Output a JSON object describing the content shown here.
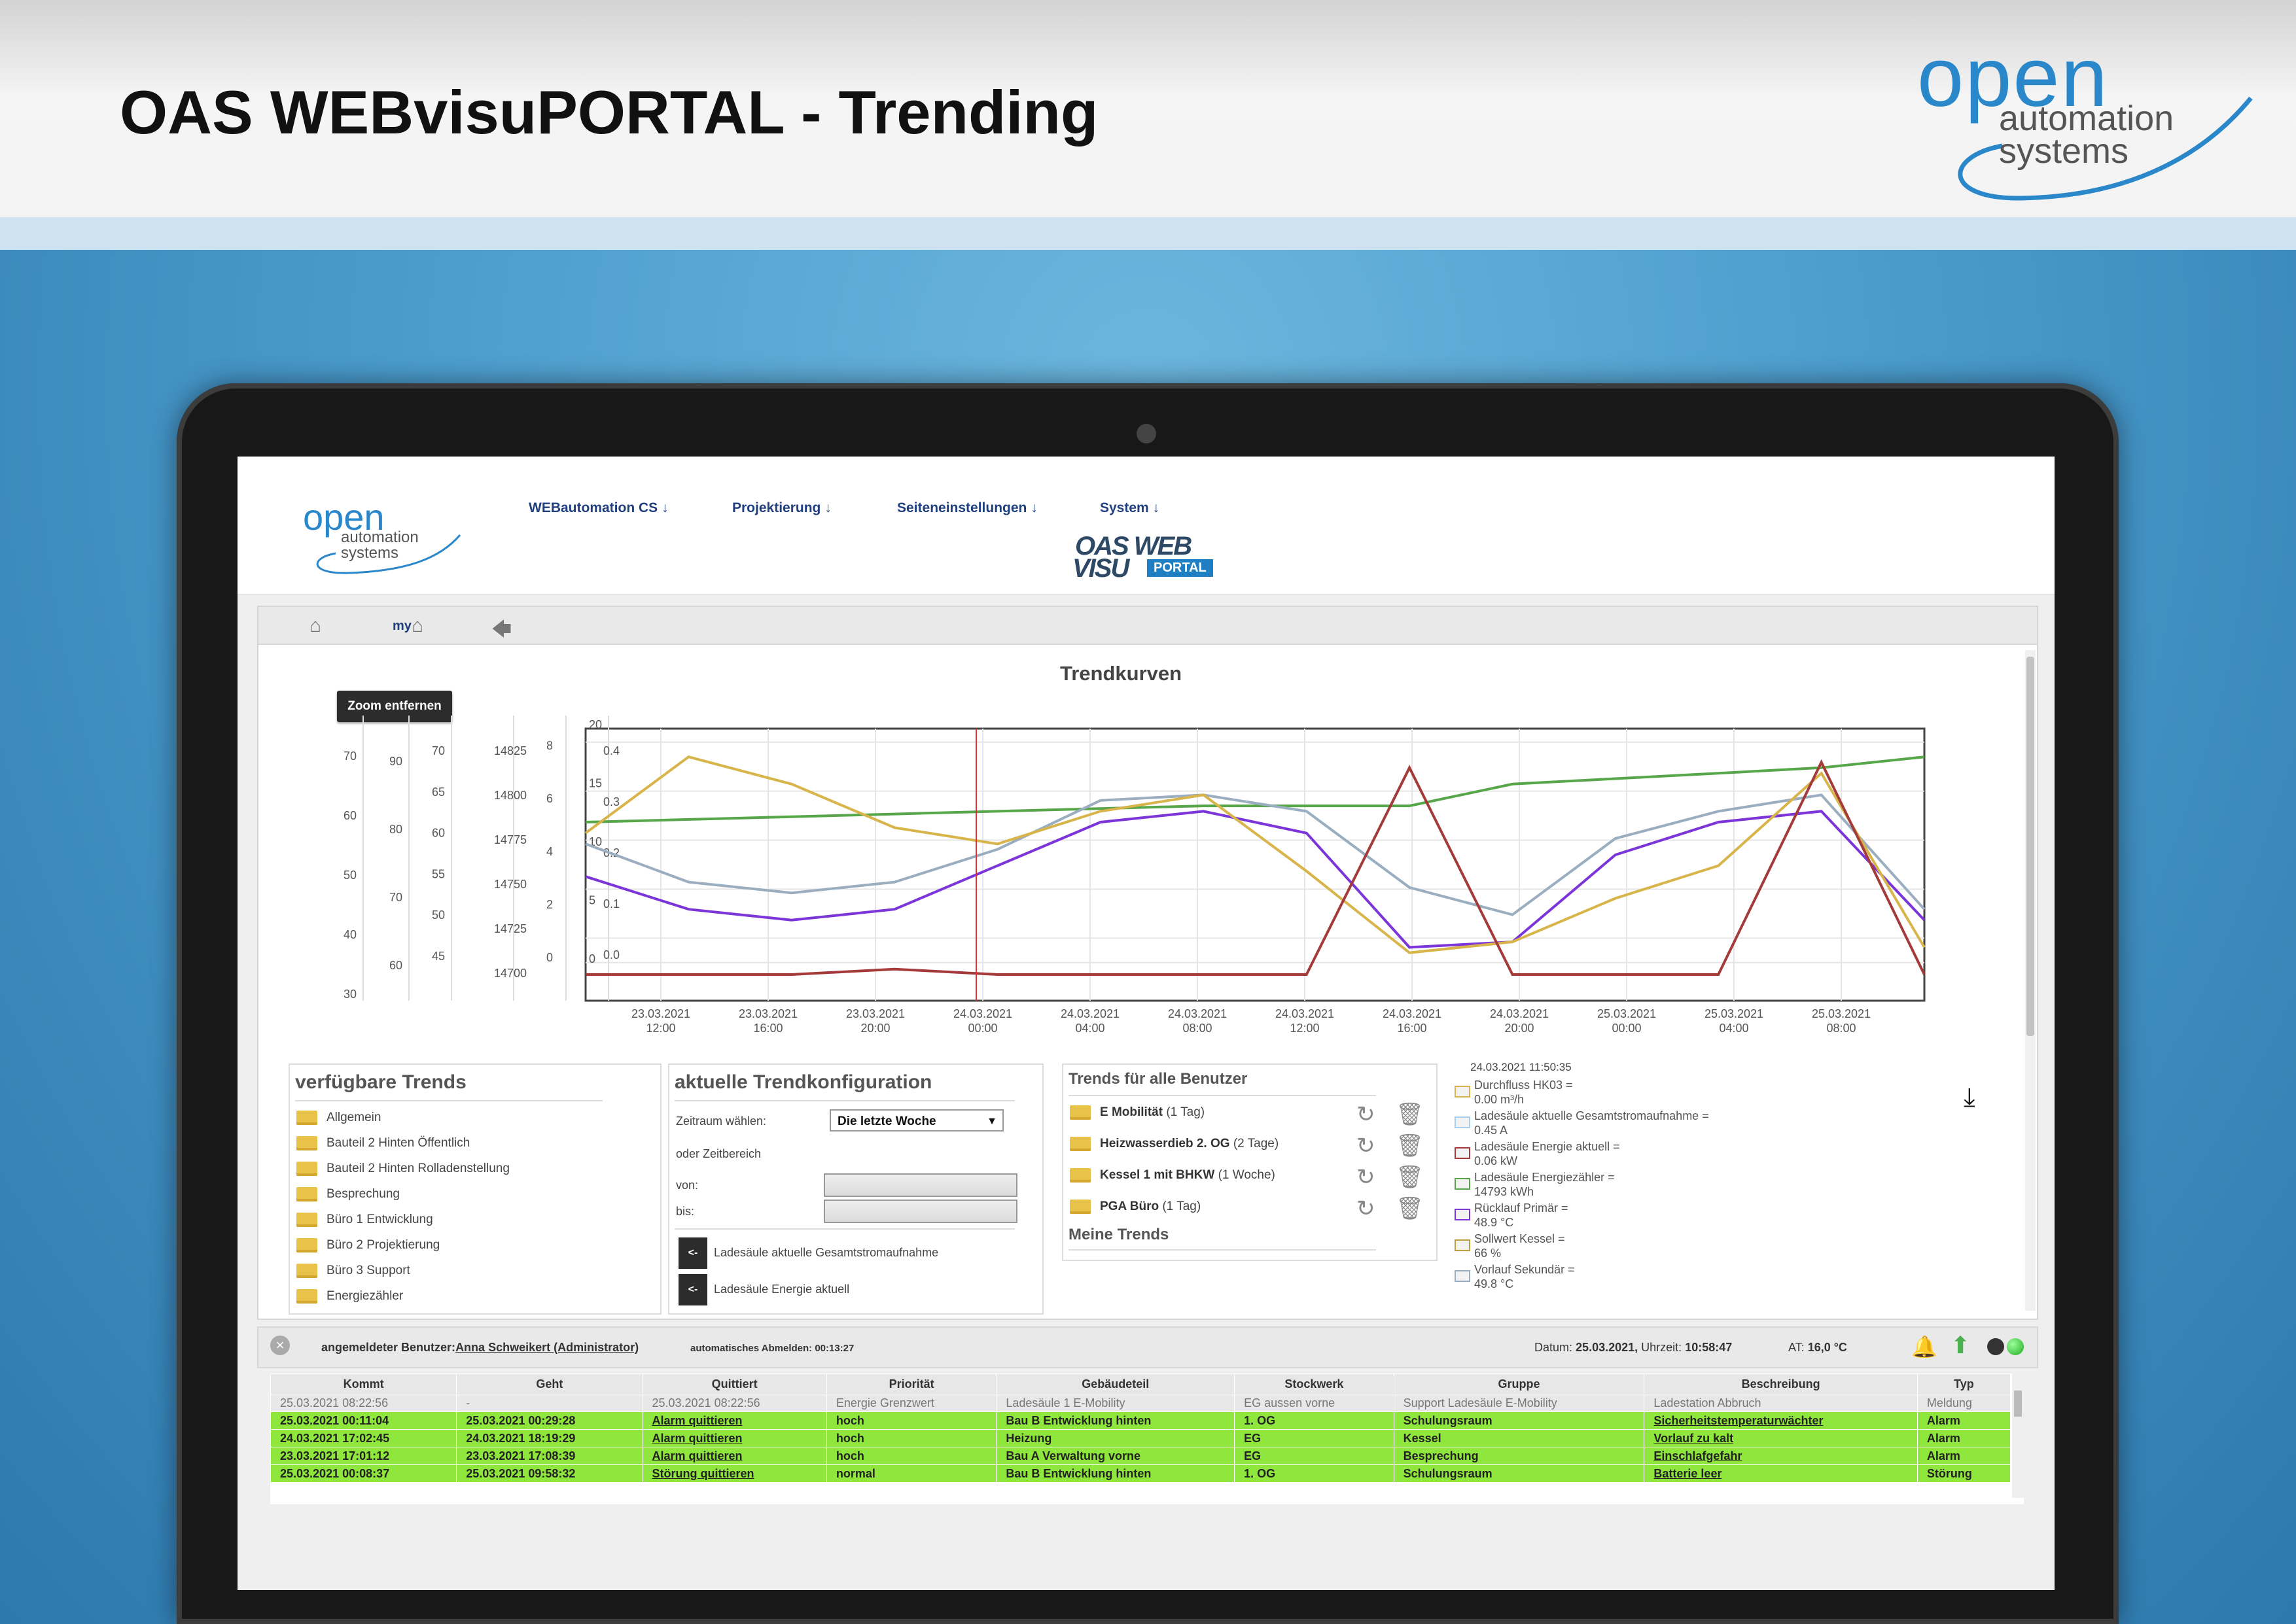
{
  "slide": {
    "title": "OAS WEBvisuPORTAL - Trending",
    "logo": {
      "line1": "open",
      "line2": "automation",
      "line3": "systems"
    }
  },
  "app": {
    "logo": {
      "line1": "open",
      "line2": "automation",
      "line3": "systems"
    },
    "nav": [
      "WEBautomation CS ↓",
      "Projektierung ↓",
      "Seiteneinstellungen ↓",
      "System ↓"
    ],
    "brand": {
      "line1": "OAS WEB",
      "line2": "VISU",
      "badge": "PORTAL"
    },
    "toolbar": {
      "my_label": "my",
      "icons": [
        "home-icon",
        "my-home-icon",
        "back-arrow-icon"
      ]
    }
  },
  "chart": {
    "title": "Trendkurven",
    "zoom_button": "Zoom entfernen"
  },
  "chart_data": {
    "type": "line",
    "title": "Trendkurven",
    "x_ticks": [
      [
        "23.03.2021",
        "12:00"
      ],
      [
        "23.03.2021",
        "16:00"
      ],
      [
        "23.03.2021",
        "20:00"
      ],
      [
        "24.03.2021",
        "00:00"
      ],
      [
        "24.03.2021",
        "04:00"
      ],
      [
        "24.03.2021",
        "08:00"
      ],
      [
        "24.03.2021",
        "12:00"
      ],
      [
        "24.03.2021",
        "16:00"
      ],
      [
        "24.03.2021",
        "20:00"
      ],
      [
        "25.03.2021",
        "00:00"
      ],
      [
        "25.03.2021",
        "04:00"
      ],
      [
        "25.03.2021",
        "08:00"
      ]
    ],
    "axes": [
      {
        "ticks": [
          "70",
          "60",
          "50",
          "40",
          "30"
        ]
      },
      {
        "ticks": [
          "90",
          "80",
          "70",
          "60"
        ]
      },
      {
        "ticks": [
          "70",
          "65",
          "60",
          "55",
          "50",
          "45"
        ]
      },
      {
        "ticks": [
          "14825",
          "14800",
          "14775",
          "14750",
          "14725",
          "14700"
        ]
      },
      {
        "ticks": [
          "8",
          "6",
          "4",
          "2",
          "0"
        ]
      },
      {
        "ticks": [
          "20",
          "15",
          "10",
          "5",
          "0"
        ]
      },
      {
        "ticks": [
          "0.4",
          "0.3",
          "0.2",
          "0.1",
          "0.0"
        ]
      }
    ],
    "series": [
      {
        "color": "#57a64a",
        "values": [
          0.28,
          0.285,
          0.29,
          0.295,
          0.3,
          0.305,
          0.31,
          0.31,
          0.31,
          0.35,
          0.36,
          0.37,
          0.38,
          0.4
        ]
      },
      {
        "color": "#9aaec0",
        "values": [
          0.24,
          0.17,
          0.15,
          0.17,
          0.23,
          0.32,
          0.33,
          0.3,
          0.16,
          0.11,
          0.25,
          0.3,
          0.33,
          0.12
        ]
      },
      {
        "color": "#7b35d8",
        "values": [
          0.18,
          0.12,
          0.1,
          0.12,
          0.2,
          0.28,
          0.3,
          0.26,
          0.05,
          0.06,
          0.22,
          0.28,
          0.3,
          0.1
        ]
      },
      {
        "color": "#d7b54b",
        "values": [
          0.26,
          0.4,
          0.35,
          0.27,
          0.24,
          0.3,
          0.33,
          0.19,
          0.04,
          0.06,
          0.14,
          0.2,
          0.37,
          0.05
        ]
      },
      {
        "color": "#a33b3b",
        "values": [
          0.0,
          0.0,
          0.0,
          0.01,
          0.0,
          0.0,
          0.0,
          0.0,
          0.38,
          0.0,
          0.0,
          0.0,
          0.39,
          0.0
        ]
      }
    ]
  },
  "panels": {
    "available": {
      "title": "verfügbare Trends",
      "items": [
        "Allgemein",
        "Bauteil 2 Hinten Öffentlich",
        "Bauteil 2 Hinten Rolladenstellung",
        "Besprechung",
        "Büro 1 Entwicklung",
        "Büro 2 Projektierung",
        "Büro 3 Support",
        "Energiezähler"
      ]
    },
    "config": {
      "title": "aktuelle Trendkonfiguration",
      "zeitraum_label": "Zeitraum wählen:",
      "zeitraum_value": "Die letzte Woche",
      "oder_label": "oder Zeitbereich",
      "von_label": "von:",
      "bis_label": "bis:",
      "selected": [
        {
          "button": "<-",
          "label": "Ladesäule aktuelle Gesamtstromaufnahme"
        },
        {
          "button": "<-",
          "label": "Ladesäule Energie aktuell"
        }
      ]
    },
    "user_trends": {
      "title": "Trends für alle Benutzer",
      "items": [
        {
          "name": "E Mobilität",
          "period": "(1 Tag)"
        },
        {
          "name": "Heizwasserdieb 2. OG",
          "period": "(2 Tage)"
        },
        {
          "name": "Kessel 1 mit BHKW",
          "period": "(1 Woche)"
        },
        {
          "name": "PGA Büro",
          "period": "(1 Tag)"
        }
      ],
      "my_trends_title": "Meine Trends"
    },
    "legend": {
      "timestamp": "24.03.2021 11:50:35",
      "items": [
        {
          "line1": "Durchfluss HK03 =",
          "line2": "0.00 m³/h",
          "color": "#d7b54b"
        },
        {
          "line1": "Ladesäule aktuelle Gesamtstromaufnahme =",
          "line2": "0.45 A",
          "color": "#a8d0ee"
        },
        {
          "line1": "Ladesäule Energie aktuell =",
          "line2": "0.06 kW",
          "color": "#a33b3b"
        },
        {
          "line1": "Ladesäule Energiezähler =",
          "line2": "14793 kWh",
          "color": "#57a64a"
        },
        {
          "line1": "Rücklauf Primär =",
          "line2": "48.9 °C",
          "color": "#7b35d8"
        },
        {
          "line1": "Sollwert Kessel =",
          "line2": "66 %",
          "color": "#b8a040"
        },
        {
          "line1": "Vorlauf Sekundär =",
          "line2": "49.8 °C",
          "color": "#9aaec0"
        }
      ]
    }
  },
  "status": {
    "user_prefix": "angemeldeter Benutzer:",
    "user_name": "Anna Schweikert (Administrator)",
    "logout": "automatisches Abmelden: 00:13:27",
    "date_label": "Datum:",
    "date": "25.03.2021,",
    "time_label": "Uhrzeit:",
    "time": "10:58:47",
    "at_label": "AT:",
    "temp": "16,0 °C"
  },
  "alarms": {
    "headers": [
      "Kommt",
      "Geht",
      "Quittiert",
      "Priorität",
      "Gebäudeteil",
      "Stockwerk",
      "Gruppe",
      "Beschreibung",
      "Typ"
    ],
    "rows": [
      [
        "25.03.2021 08:22:56",
        "-",
        "25.03.2021 08:22:56",
        "Energie Grenzwert",
        "Ladesäule 1 E-Mobility",
        "EG aussen vorne",
        "Support Ladesäule E-Mobility",
        "Ladestation Abbruch",
        "Meldung"
      ],
      [
        "25.03.2021 00:11:04",
        "25.03.2021 00:29:28",
        "Alarm quittieren",
        "hoch",
        "Bau B Entwicklung hinten",
        "1. OG",
        "Schulungsraum",
        "Sicherheitstemperaturwächter",
        "Alarm"
      ],
      [
        "24.03.2021 17:02:45",
        "24.03.2021 18:19:29",
        "Alarm quittieren",
        "hoch",
        "Heizung",
        "EG",
        "Kessel",
        "Vorlauf zu kalt",
        "Alarm"
      ],
      [
        "23.03.2021 17:01:12",
        "23.03.2021 17:08:39",
        "Alarm quittieren",
        "hoch",
        "Bau A Verwaltung vorne",
        "EG",
        "Besprechung",
        "Einschlafgefahr",
        "Alarm"
      ],
      [
        "25.03.2021 00:08:37",
        "25.03.2021 09:58:32",
        "Störung quittieren",
        "normal",
        "Bau B Entwicklung hinten",
        "1. OG",
        "Schulungsraum",
        "Batterie leer",
        "Störung"
      ]
    ]
  }
}
